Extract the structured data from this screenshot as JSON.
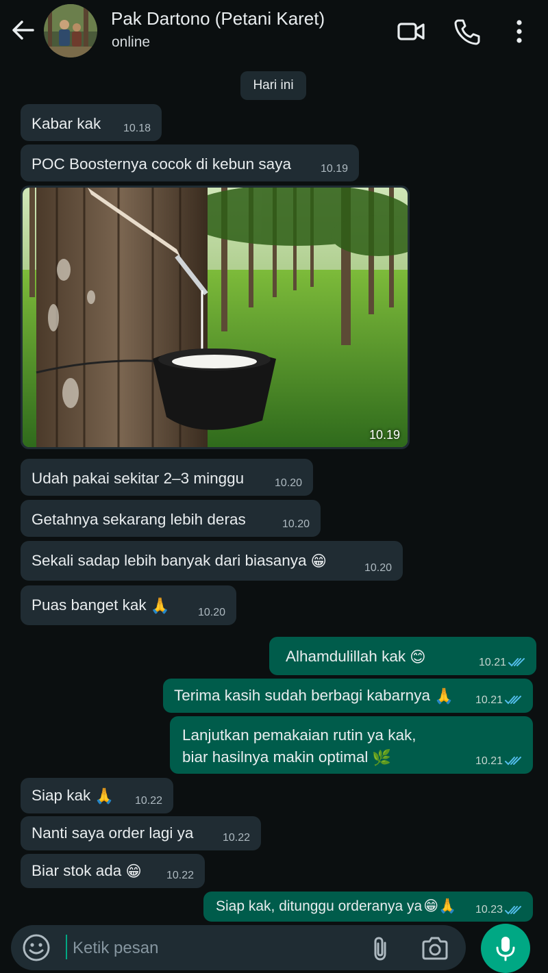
{
  "header": {
    "contact_name": "Pak Dartono (Petani Karet)",
    "status": "online",
    "icons": [
      "arrow-left-icon",
      "video-call-icon",
      "phone-icon",
      "more-vertical-icon"
    ]
  },
  "chat": {
    "date_chip": "Hari ini",
    "messages": [
      {
        "dir": "in",
        "text": "Kabar kak",
        "time": "10.18"
      },
      {
        "dir": "in",
        "text": "POC Boosternya cocok di kebun saya",
        "time": "10.19"
      },
      {
        "dir": "in",
        "type": "image",
        "alt": "rubber tree tapping with latex cup",
        "time": "10.19"
      },
      {
        "dir": "in",
        "text": "Udah pakai sekitar 2–3 minggu",
        "time": "10.20"
      },
      {
        "dir": "in",
        "text": "Getahnya sekarang lebih deras",
        "time": "10.20"
      },
      {
        "dir": "in",
        "text": "Sekali sadap lebih banyak dari biasanya",
        "emoji": "😁",
        "time": "10.20"
      },
      {
        "dir": "in",
        "text": "Puas banget kak",
        "emoji": "🙏",
        "time": "10.20"
      },
      {
        "dir": "out",
        "text": "Alhamdulillah kak",
        "emoji": "😊",
        "time": "10.21",
        "status": "read"
      },
      {
        "dir": "out",
        "text": "Terima kasih sudah berbagi kabarnya",
        "emoji": "🙏",
        "time": "10.21",
        "status": "read"
      },
      {
        "dir": "out",
        "line1": "Lanjutkan pemakaian rutin ya kak,",
        "line2": "biar hasilnya makin optimal",
        "emoji": "🌿",
        "time": "10.21",
        "status": "read"
      },
      {
        "dir": "in",
        "text": "Siap kak",
        "emoji": "🙏",
        "time": "10.22"
      },
      {
        "dir": "in",
        "text": "Nanti saya order lagi ya",
        "time": "10.22"
      },
      {
        "dir": "in",
        "text": "Biar stok ada",
        "emoji": "😁",
        "time": "10.22"
      },
      {
        "dir": "out",
        "text": "Siap kak, ditunggu orderanya ya",
        "emoji": "😁🙏",
        "time": "10.23",
        "status": "read"
      }
    ]
  },
  "composer": {
    "placeholder": "Ketik pesan",
    "icons": [
      "emoji-icon",
      "attach-icon",
      "camera-icon",
      "mic-icon"
    ]
  },
  "colors": {
    "background": "#0b0f10",
    "incoming_bubble": "#202c33",
    "outgoing_bubble": "#005c4b",
    "accent": "#00a884",
    "read_ticks": "#53bdeb"
  }
}
